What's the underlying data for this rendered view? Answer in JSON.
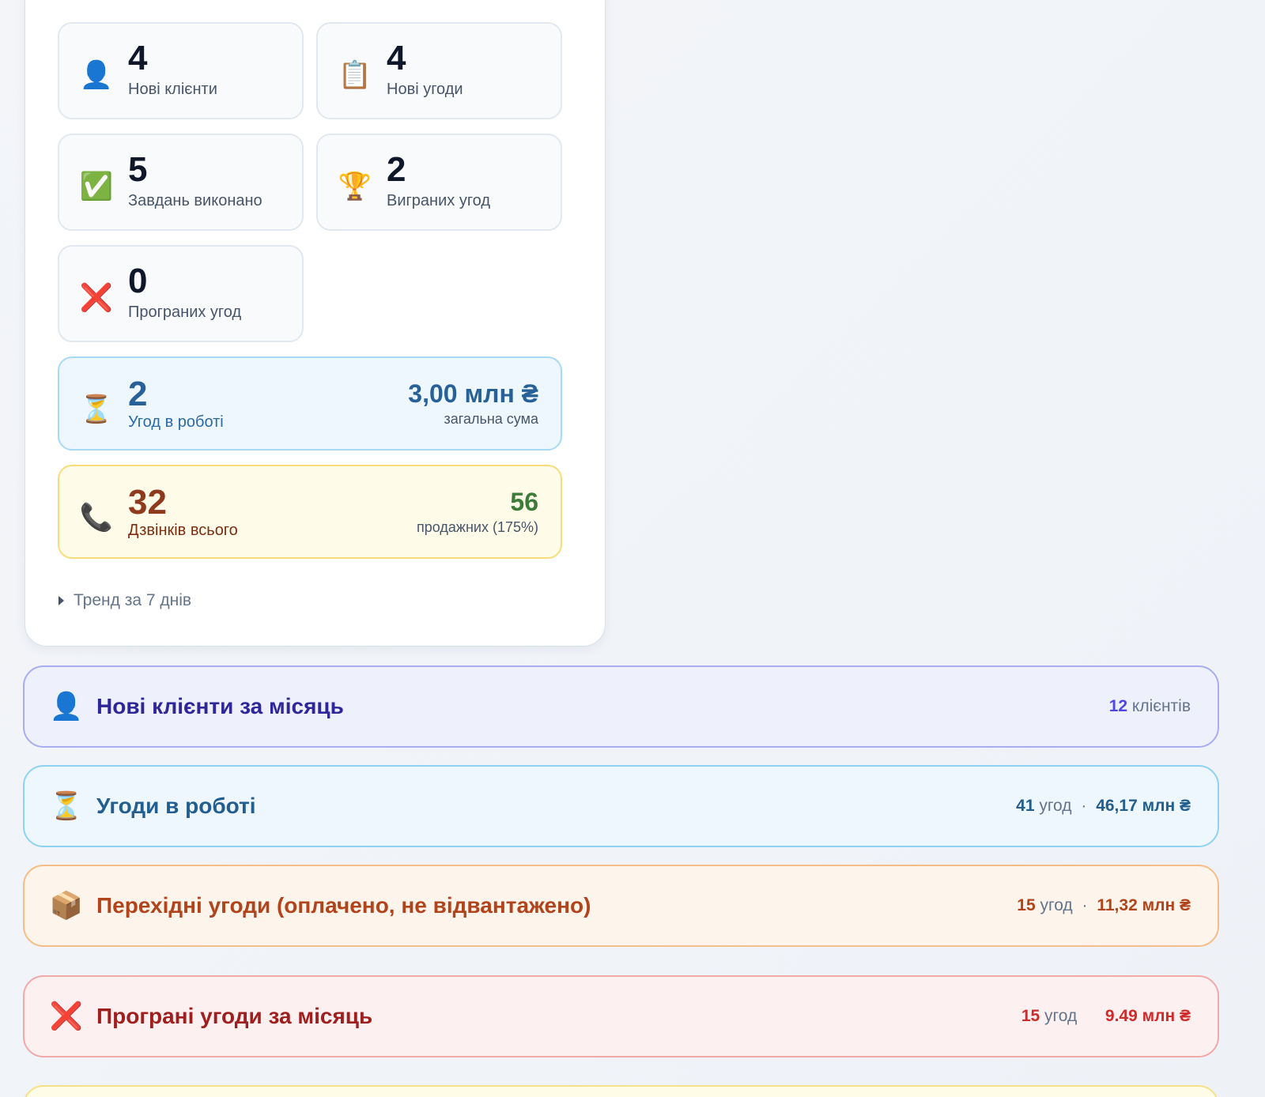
{
  "daily": {
    "new_clients": {
      "icon": "👤",
      "value": "4",
      "label": "Нові клієнти"
    },
    "new_deals": {
      "icon": "📋",
      "value": "4",
      "label": "Нові угоди"
    },
    "tasks_done": {
      "icon": "✅",
      "value": "5",
      "label": "Завдань виконано"
    },
    "won_deals": {
      "icon": "🏆",
      "value": "2",
      "label": "Виграних угод"
    },
    "lost_deals": {
      "icon": "❌",
      "value": "0",
      "label": "Програних угод"
    },
    "in_work": {
      "icon": "⏳",
      "value": "2",
      "label": "Угод в роботі",
      "total": "3,00 млн ₴",
      "total_label": "загальна сума"
    },
    "calls": {
      "icon": "📞",
      "value": "32",
      "label": "Дзвінків всього",
      "sales": "56",
      "sales_label": "продажних (175%)"
    },
    "trend_label": "Тренд за 7 днів"
  },
  "sections": {
    "clients": {
      "icon": "👤",
      "title": "Нові клієнти за місяць",
      "count": "12",
      "count_unit": "клієнтів"
    },
    "work": {
      "icon": "⏳",
      "title": "Угоди в роботі",
      "count": "41",
      "count_unit": "угод",
      "sep": "·",
      "sum": "46,17 млн ₴"
    },
    "transit": {
      "icon": "📦",
      "title": "Перехідні угоди (оплачено, не відвантажено)",
      "count": "15",
      "count_unit": "угод",
      "sep": "·",
      "sum": "11,32 млн ₴"
    },
    "lost": {
      "icon": "❌",
      "title": "Програні угоди за місяць",
      "count": "15",
      "count_unit": "угод",
      "sum": "9.49 млн ₴"
    }
  },
  "colors": {
    "clients_accent": "#4f46e5",
    "work_accent": "#225e8f",
    "transit_accent": "#b1441a",
    "lost_accent": "#d02b2b",
    "sales_green": "#3d7c38"
  }
}
